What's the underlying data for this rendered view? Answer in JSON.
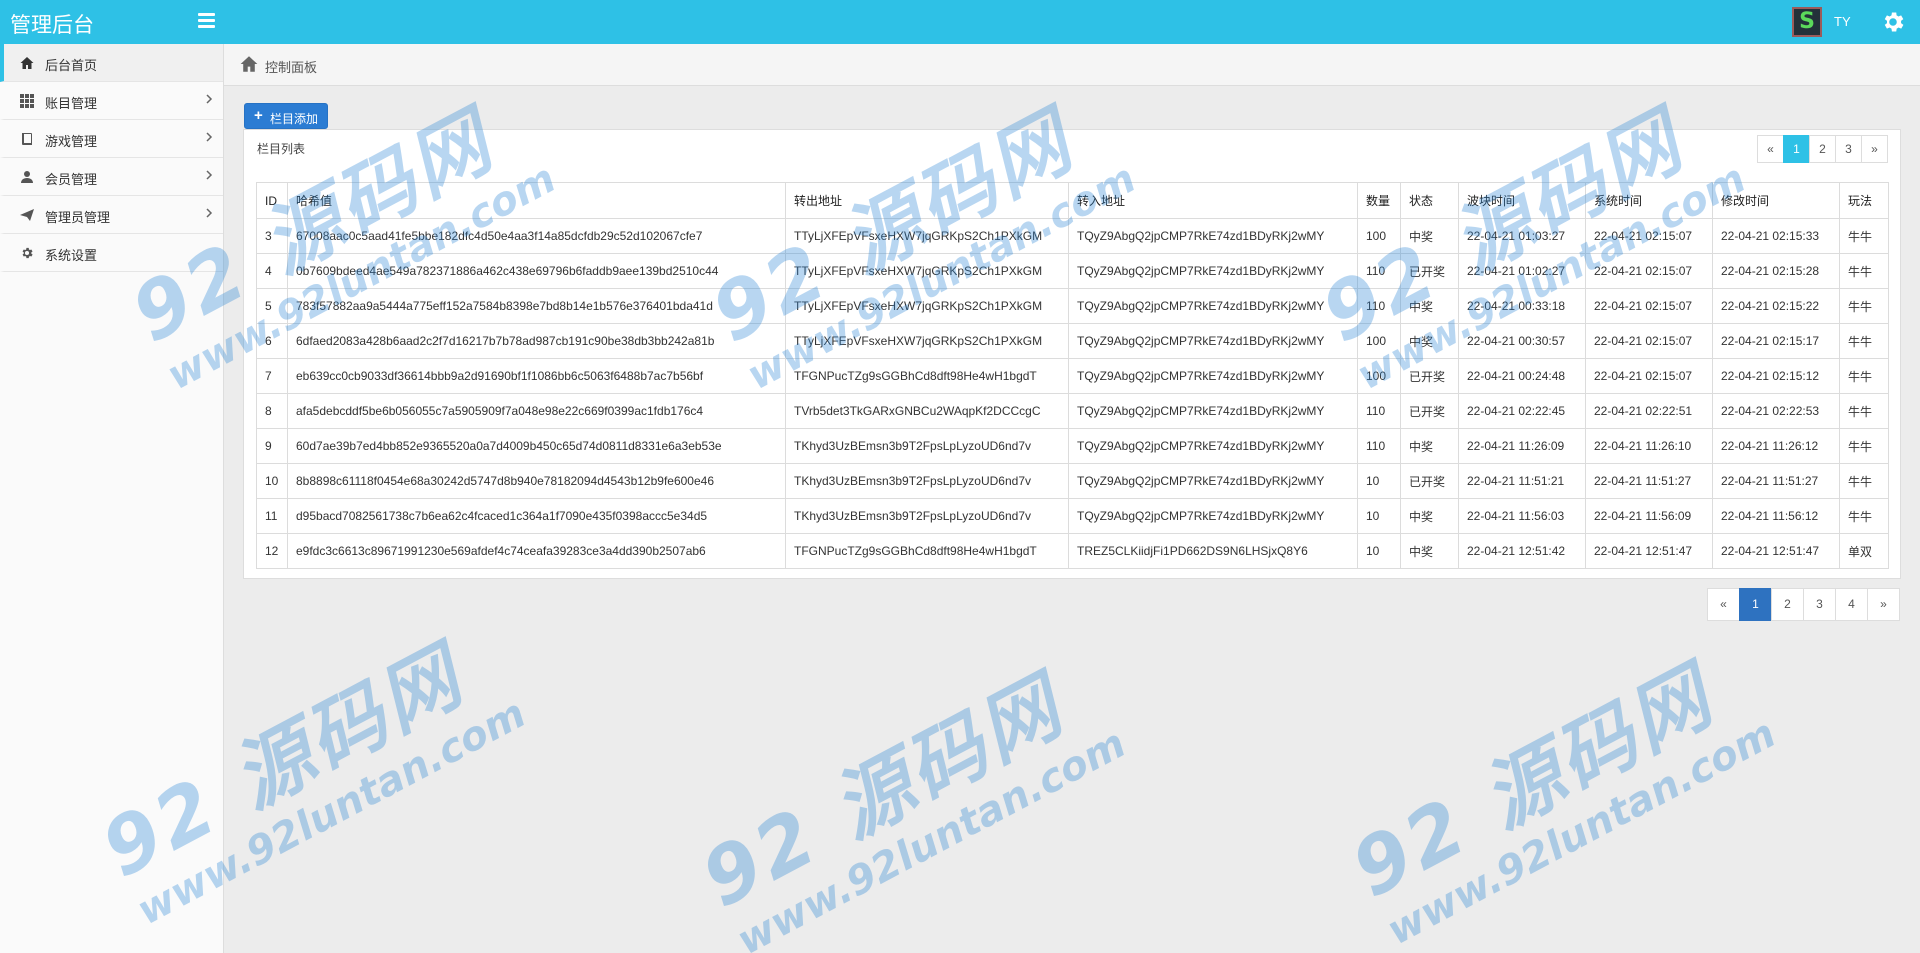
{
  "app": {
    "title": "管理后台",
    "user": "TY",
    "avatar_letter": "S"
  },
  "sidebar": {
    "items": [
      {
        "label": "后台首页",
        "icon": "home-icon",
        "active": true
      },
      {
        "label": "账目管理",
        "icon": "grid-icon"
      },
      {
        "label": "游戏管理",
        "icon": "book-icon"
      },
      {
        "label": "会员管理",
        "icon": "user-icon"
      },
      {
        "label": "管理员管理",
        "icon": "send-icon"
      },
      {
        "label": "系统设置",
        "icon": "gear-icon"
      }
    ]
  },
  "breadcrumb": {
    "label": "控制面板"
  },
  "toolbar": {
    "add_label": "栏目添加"
  },
  "panel": {
    "title": "栏目列表"
  },
  "pager_top": {
    "prev": "«",
    "pages": [
      "1",
      "2",
      "3"
    ],
    "active": "1",
    "next": "»"
  },
  "pager_bottom": {
    "prev": "«",
    "pages": [
      "1",
      "2",
      "3",
      "4"
    ],
    "active": "1",
    "next": "»"
  },
  "table": {
    "headers": [
      "ID",
      "哈希值",
      "转出地址",
      "转入地址",
      "数量",
      "状态",
      "波块时间",
      "系统时间",
      "修改时间",
      "玩法"
    ],
    "rows": [
      [
        "3",
        "67008aac0c5aad41fe5bbe182dfc4d50e4aa3f14a85dcfdb29c52d102067cfe7",
        "TTyLjXFEpVFsxeHXW7jqGRKpS2Ch1PXkGM",
        "TQyZ9AbgQ2jpCMP7RkE74zd1BDyRKj2wMY",
        "100",
        "中奖",
        "22-04-21 01:03:27",
        "22-04-21 02:15:07",
        "22-04-21 02:15:33",
        "牛牛"
      ],
      [
        "4",
        "0b7609bdeed4ae549a782371886a462c438e69796b6faddb9aee139bd2510c44",
        "TTyLjXFEpVFsxeHXW7jqGRKpS2Ch1PXkGM",
        "TQyZ9AbgQ2jpCMP7RkE74zd1BDyRKj2wMY",
        "110",
        "已开奖",
        "22-04-21 01:02:27",
        "22-04-21 02:15:07",
        "22-04-21 02:15:28",
        "牛牛"
      ],
      [
        "5",
        "783f57882aa9a5444a775eff152a7584b8398e7bd8b14e1b576e376401bda41d",
        "TTyLjXFEpVFsxeHXW7jqGRKpS2Ch1PXkGM",
        "TQyZ9AbgQ2jpCMP7RkE74zd1BDyRKj2wMY",
        "110",
        "中奖",
        "22-04-21 00:33:18",
        "22-04-21 02:15:07",
        "22-04-21 02:15:22",
        "牛牛"
      ],
      [
        "6",
        "6dfaed2083a428b6aad2c2f7d16217b7b78ad987cb191c90be38db3bb242a81b",
        "TTyLjXFEpVFsxeHXW7jqGRKpS2Ch1PXkGM",
        "TQyZ9AbgQ2jpCMP7RkE74zd1BDyRKj2wMY",
        "100",
        "中奖",
        "22-04-21 00:30:57",
        "22-04-21 02:15:07",
        "22-04-21 02:15:17",
        "牛牛"
      ],
      [
        "7",
        "eb639cc0cb9033df36614bbb9a2d91690bf1f1086bb6c5063f6488b7ac7b56bf",
        "TFGNPucTZg9sGGBhCd8dft98He4wH1bgdT",
        "TQyZ9AbgQ2jpCMP7RkE74zd1BDyRKj2wMY",
        "100",
        "已开奖",
        "22-04-21 00:24:48",
        "22-04-21 02:15:07",
        "22-04-21 02:15:12",
        "牛牛"
      ],
      [
        "8",
        "afa5debcddf5be6b056055c7a5905909f7a048e98e22c669f0399ac1fdb176c4",
        "TVrb5det3TkGARxGNBCu2WAqpKf2DCCcgC",
        "TQyZ9AbgQ2jpCMP7RkE74zd1BDyRKj2wMY",
        "110",
        "已开奖",
        "22-04-21 02:22:45",
        "22-04-21 02:22:51",
        "22-04-21 02:22:53",
        "牛牛"
      ],
      [
        "9",
        "60d7ae39b7ed4bb852e9365520a0a7d4009b450c65d74d0811d8331e6a3eb53e",
        "TKhyd3UzBEmsn3b9T2FpsLpLyzoUD6nd7v",
        "TQyZ9AbgQ2jpCMP7RkE74zd1BDyRKj2wMY",
        "110",
        "中奖",
        "22-04-21 11:26:09",
        "22-04-21 11:26:10",
        "22-04-21 11:26:12",
        "牛牛"
      ],
      [
        "10",
        "8b8898c61118f0454e68a30242d5747d8b940e78182094d4543b12b9fe600e46",
        "TKhyd3UzBEmsn3b9T2FpsLpLyzoUD6nd7v",
        "TQyZ9AbgQ2jpCMP7RkE74zd1BDyRKj2wMY",
        "10",
        "已开奖",
        "22-04-21 11:51:21",
        "22-04-21 11:51:27",
        "22-04-21 11:51:27",
        "牛牛"
      ],
      [
        "11",
        "d95bacd7082561738c7b6ea62c4fcaced1c364a1f7090e435f0398accc5e34d5",
        "TKhyd3UzBEmsn3b9T2FpsLpLyzoUD6nd7v",
        "TQyZ9AbgQ2jpCMP7RkE74zd1BDyRKj2wMY",
        "10",
        "中奖",
        "22-04-21 11:56:03",
        "22-04-21 11:56:09",
        "22-04-21 11:56:12",
        "牛牛"
      ],
      [
        "12",
        "e9fdc3c6613c89671991230e569afdef4c74ceafa39283ce3a4dd390b2507ab6",
        "TFGNPucTZg9sGGBhCd8dft98He4wH1bgdT",
        "TREZ5CLKiidjFi1PD662DS9N6LHSjxQ8Y6",
        "10",
        "中奖",
        "22-04-21 12:51:42",
        "22-04-21 12:51:47",
        "22-04-21 12:51:47",
        "单双"
      ]
    ]
  },
  "watermark": {
    "logo": "92 源码网",
    "url": "www.92luntan.com"
  },
  "colors": {
    "topbar": "#2ec1e6",
    "accent_button": "#2b7cd3",
    "pager_active_top": "#2ec1e6",
    "pager_active_bottom": "#2e72c0"
  }
}
